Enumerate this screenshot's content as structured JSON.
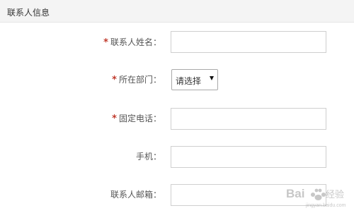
{
  "section": {
    "title": "联系人信息"
  },
  "form": {
    "required_mark": "*",
    "fields": [
      {
        "label": "联系人姓名：",
        "required": true,
        "type": "text",
        "value": ""
      },
      {
        "label": "所在部门：",
        "required": true,
        "type": "select",
        "value": "请选择"
      },
      {
        "label": "固定电话：",
        "required": true,
        "type": "text",
        "value": ""
      },
      {
        "label": "手机：",
        "required": false,
        "type": "text",
        "value": ""
      },
      {
        "label": "联系人邮箱：",
        "required": false,
        "type": "text",
        "value": ""
      }
    ]
  },
  "watermark": {
    "brand": "Bai du 经验",
    "url": "jingyan.baidu.com"
  },
  "colors": {
    "required": "#c0392b",
    "header_bg": "#f4f4f4",
    "input_border": "#cfcfcf"
  }
}
